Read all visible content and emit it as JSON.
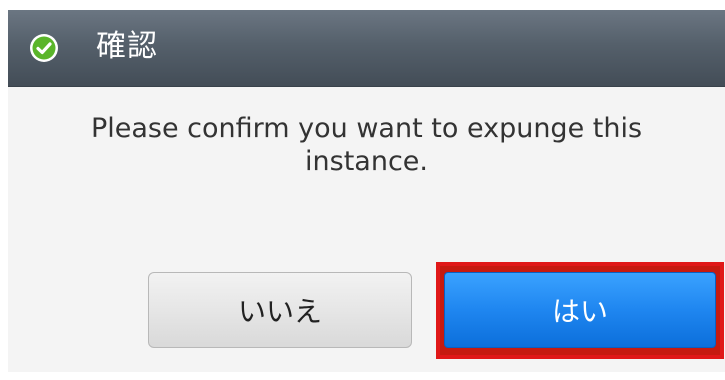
{
  "dialog": {
    "title": "確認",
    "title_icon": "check-circle-icon",
    "message": "Please confirm you want to expunge this instance.",
    "buttons": {
      "no_label": "いいえ",
      "yes_label": "はい"
    }
  },
  "colors": {
    "titlebar": "#55606b",
    "check_green": "#5ab52a",
    "primary_button": "#1f86f0",
    "highlight_border": "#e01818"
  }
}
